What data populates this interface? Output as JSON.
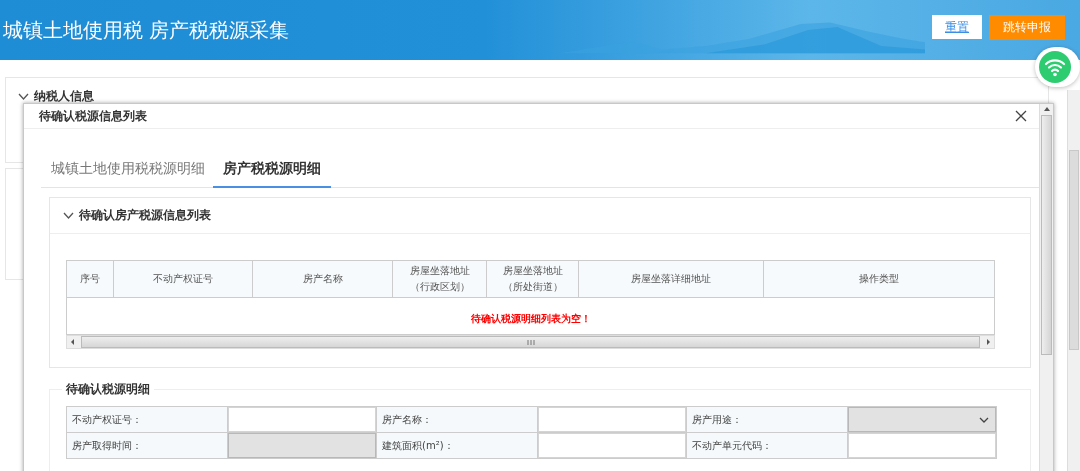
{
  "header": {
    "title": "城镇土地使用税 房产税税源采集",
    "buttons": [
      {
        "label": "重置",
        "kind": "secondary"
      },
      {
        "label": "跳转申报",
        "kind": "primary"
      }
    ]
  },
  "background_page": {
    "section_title": "纳税人信息",
    "expanded": true
  },
  "dialog": {
    "title": "待确认税源信息列表",
    "tabs": [
      {
        "label": "城镇土地使用税税源明细",
        "selected": false
      },
      {
        "label": "房产税税源明细",
        "selected": true
      }
    ],
    "list_panel": {
      "title": "待确认房产税源信息列表",
      "expanded": true,
      "columns": [
        {
          "label": "序号"
        },
        {
          "label": "不动产权证号"
        },
        {
          "label": "房产名称"
        },
        {
          "label": "房屋坐落地址",
          "sublabel": "（行政区划）"
        },
        {
          "label": "房屋坐落地址",
          "sublabel": "（所处街道）"
        },
        {
          "label": "房屋坐落详细地址"
        },
        {
          "label": "操作类型"
        }
      ],
      "empty_message": "待确认税源明细列表为空！"
    },
    "detail_panel": {
      "title": "待确认税源明细",
      "rows": [
        [
          {
            "label": "不动产权证号：",
            "kind": "text",
            "disabled": false
          },
          {
            "label": "房产名称：",
            "kind": "text",
            "disabled": false
          },
          {
            "label": "房产用途：",
            "kind": "select",
            "disabled": true
          }
        ],
        [
          {
            "label": "房产取得时间：",
            "kind": "text",
            "disabled": true
          },
          {
            "label": "建筑面积(m²)：",
            "kind": "text",
            "disabled": false
          },
          {
            "label": "不动产单元代码：",
            "kind": "text",
            "disabled": false
          }
        ]
      ]
    }
  }
}
